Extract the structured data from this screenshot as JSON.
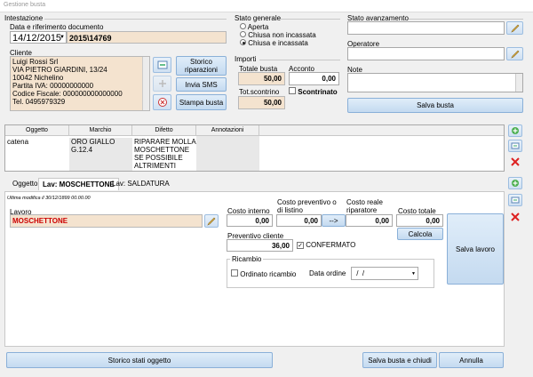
{
  "window": {
    "title": "Gestione busta"
  },
  "intestazione": {
    "section_label": "Intestazione",
    "date_label": "Data e riferimento documento",
    "date_value": "14/12/2015",
    "ref_value": "2015\\14769",
    "cliente_label": "Cliente",
    "cliente_text": "Luigi Rossi Srl\nVIA PIETRO GIARDINI, 13/24\n10042 Nichelino\nPartita IVA: 00000000000\nCodice Fiscale: 000000000000000\nTel. 0495979329",
    "storico_btn": "Storico riparazioni",
    "sms_btn": "Invia SMS",
    "stampa_btn": "Stampa busta"
  },
  "stato_generale": {
    "label": "Stato generale",
    "options": [
      "Aperta",
      "Chiusa non incassata",
      "Chiusa e incassata"
    ],
    "selected_index": 2
  },
  "importi": {
    "label": "Importi",
    "totale_label": "Totale busta",
    "totale_value": "50,00",
    "acconto_label": "Acconto",
    "acconto_value": "0,00",
    "scontrino_label": "Tot.scontrino",
    "scontrino_value": "50,00",
    "scontrinato_label": "Scontrinato"
  },
  "avanzamento": {
    "label": "Stato avanzamento",
    "operatore_label": "Operatore",
    "note_label": "Note",
    "salva_btn": "Salva busta"
  },
  "oggetti_table": {
    "headers": [
      "Oggetto",
      "Marchio",
      "Difetto",
      "Annotazioni"
    ],
    "rows": [
      {
        "oggetto": "catena",
        "marchio": "ORO GIALLO G.12.4",
        "difetto": "RIPARARE MOLLA MOSCHETTONE SE POSSIBILE ALTRIMENTI",
        "annotazioni": ""
      }
    ]
  },
  "tabs": [
    "Oggetto",
    "Lav: MOSCHETTONE",
    "Lav: SALDATURA"
  ],
  "selected_tab": 1,
  "lavoro": {
    "last_modified": "Ultima modifica il 30/12/1899 00.00.00",
    "lavoro_label": "Lavoro",
    "lavoro_value": "MOSCHETTONE",
    "costo_interno_label": "Costo interno",
    "costo_interno_value": "0,00",
    "costo_prev_label": "Costo preventivo o di listino",
    "costo_prev_value": "0,00",
    "arrow_btn": "-->",
    "costo_reale_label": "Costo reale riparatore",
    "costo_reale_value": "0,00",
    "costo_totale_label": "Costo totale",
    "costo_totale_value": "0,00",
    "calcola_btn": "Calcola",
    "preventivo_label": "Preventivo cliente",
    "preventivo_value": "36,00",
    "confermato_label": "CONFERMATO",
    "salva_lavoro_btn": "Salva lavoro",
    "ricambio_label": "Ricambio",
    "ordinato_label": "Ordinato ricambio",
    "data_ordine_label": "Data ordine",
    "data_ordine_value": " /  /"
  },
  "footer": {
    "storico_btn": "Storico stati oggetto",
    "salva_chiudi_btn": "Salva busta e chiudi",
    "annulla_btn": "Annulla"
  },
  "colors": {
    "readonly_bg": "#f4e3cf",
    "lavoro_text": "#cc0000",
    "button_blue": "#c4daf0"
  }
}
